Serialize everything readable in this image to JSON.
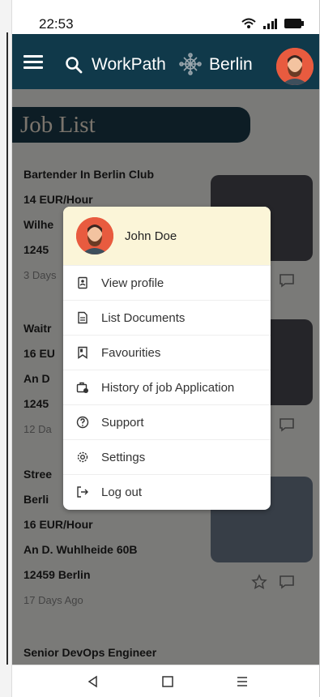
{
  "status_bar": {
    "time": "22:53"
  },
  "app_bar": {
    "title": "WorkPath",
    "city": "Berlin"
  },
  "page_heading": "Job List",
  "jobs": [
    {
      "title": "Bartender In Berlin Club",
      "pay": "14 EUR/Hour",
      "street": "Wilhe",
      "zip": "1245",
      "ago": "3 Days"
    },
    {
      "title": "Waitr",
      "pay": "16 EU",
      "street": "An D",
      "zip": "1245",
      "ago": "12 Da"
    },
    {
      "title": "Stree",
      "location": "Berli",
      "pay": "16 EUR/Hour",
      "street": "An D. Wuhlheide 60B",
      "zip": "12459 Berlin",
      "ago": "17 Days Ago"
    },
    {
      "title": "Senior DevOps Engineer"
    }
  ],
  "user_menu": {
    "user_name": "John Doe",
    "items": [
      {
        "label": "View profile",
        "icon": "id-card-icon"
      },
      {
        "label": "List Documents",
        "icon": "document-icon"
      },
      {
        "label": "Favourities",
        "icon": "bookmark-icon"
      },
      {
        "label": "History of job Application",
        "icon": "briefcase-history-icon"
      },
      {
        "label": "Support",
        "icon": "help-circle-icon"
      },
      {
        "label": "Settings",
        "icon": "gear-icon"
      },
      {
        "label": "Log out",
        "icon": "logout-icon"
      }
    ]
  },
  "colors": {
    "app_bar": "#10394a",
    "menu_header": "#fbf5d8",
    "avatar": "#e85b3f"
  }
}
